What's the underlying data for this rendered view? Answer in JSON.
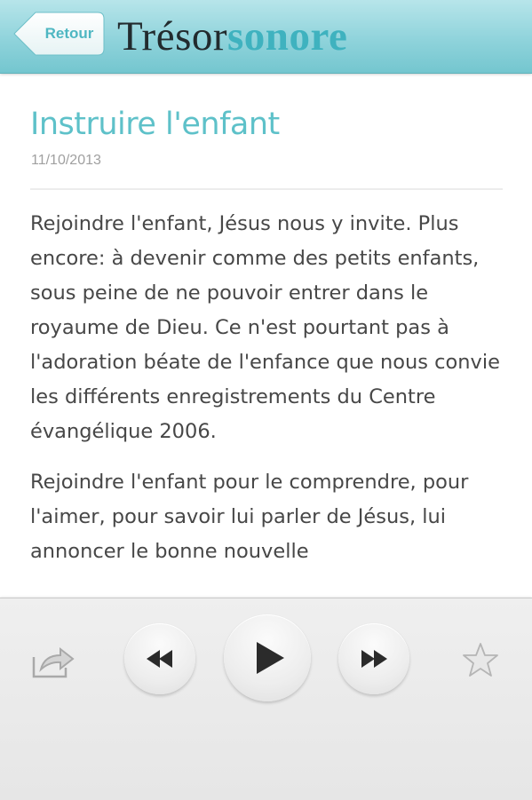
{
  "header": {
    "back_label": "Retour",
    "logo_part1": "Trésor",
    "logo_part2": "sonore"
  },
  "article": {
    "title": "Instruire l'enfant",
    "date": "11/10/2013",
    "paragraphs": [
      "Rejoindre l'enfant, Jésus nous y invite. Plus encore: à devenir comme des petits enfants, sous peine de ne pouvoir entrer dans le royaume de Dieu. Ce n'est pourtant pas à l'adoration béate de l'enfance que nous convie les différents enregistrements du Centre évangélique 2006.",
      "Rejoindre l'enfant pour le comprendre, pour l'aimer, pour savoir lui parler de Jésus, lui annoncer le bonne nouvelle"
    ]
  },
  "player": {
    "controls": [
      "share-icon",
      "rewind-icon",
      "play-icon",
      "fast-forward-icon",
      "star-icon"
    ]
  },
  "colors": {
    "header_top": "#b7e5ea",
    "header_bottom": "#74c6cf",
    "accent": "#3fb2bf",
    "title": "#5ec1c9",
    "body_text": "#474747",
    "date_text": "#a0a0a0"
  }
}
